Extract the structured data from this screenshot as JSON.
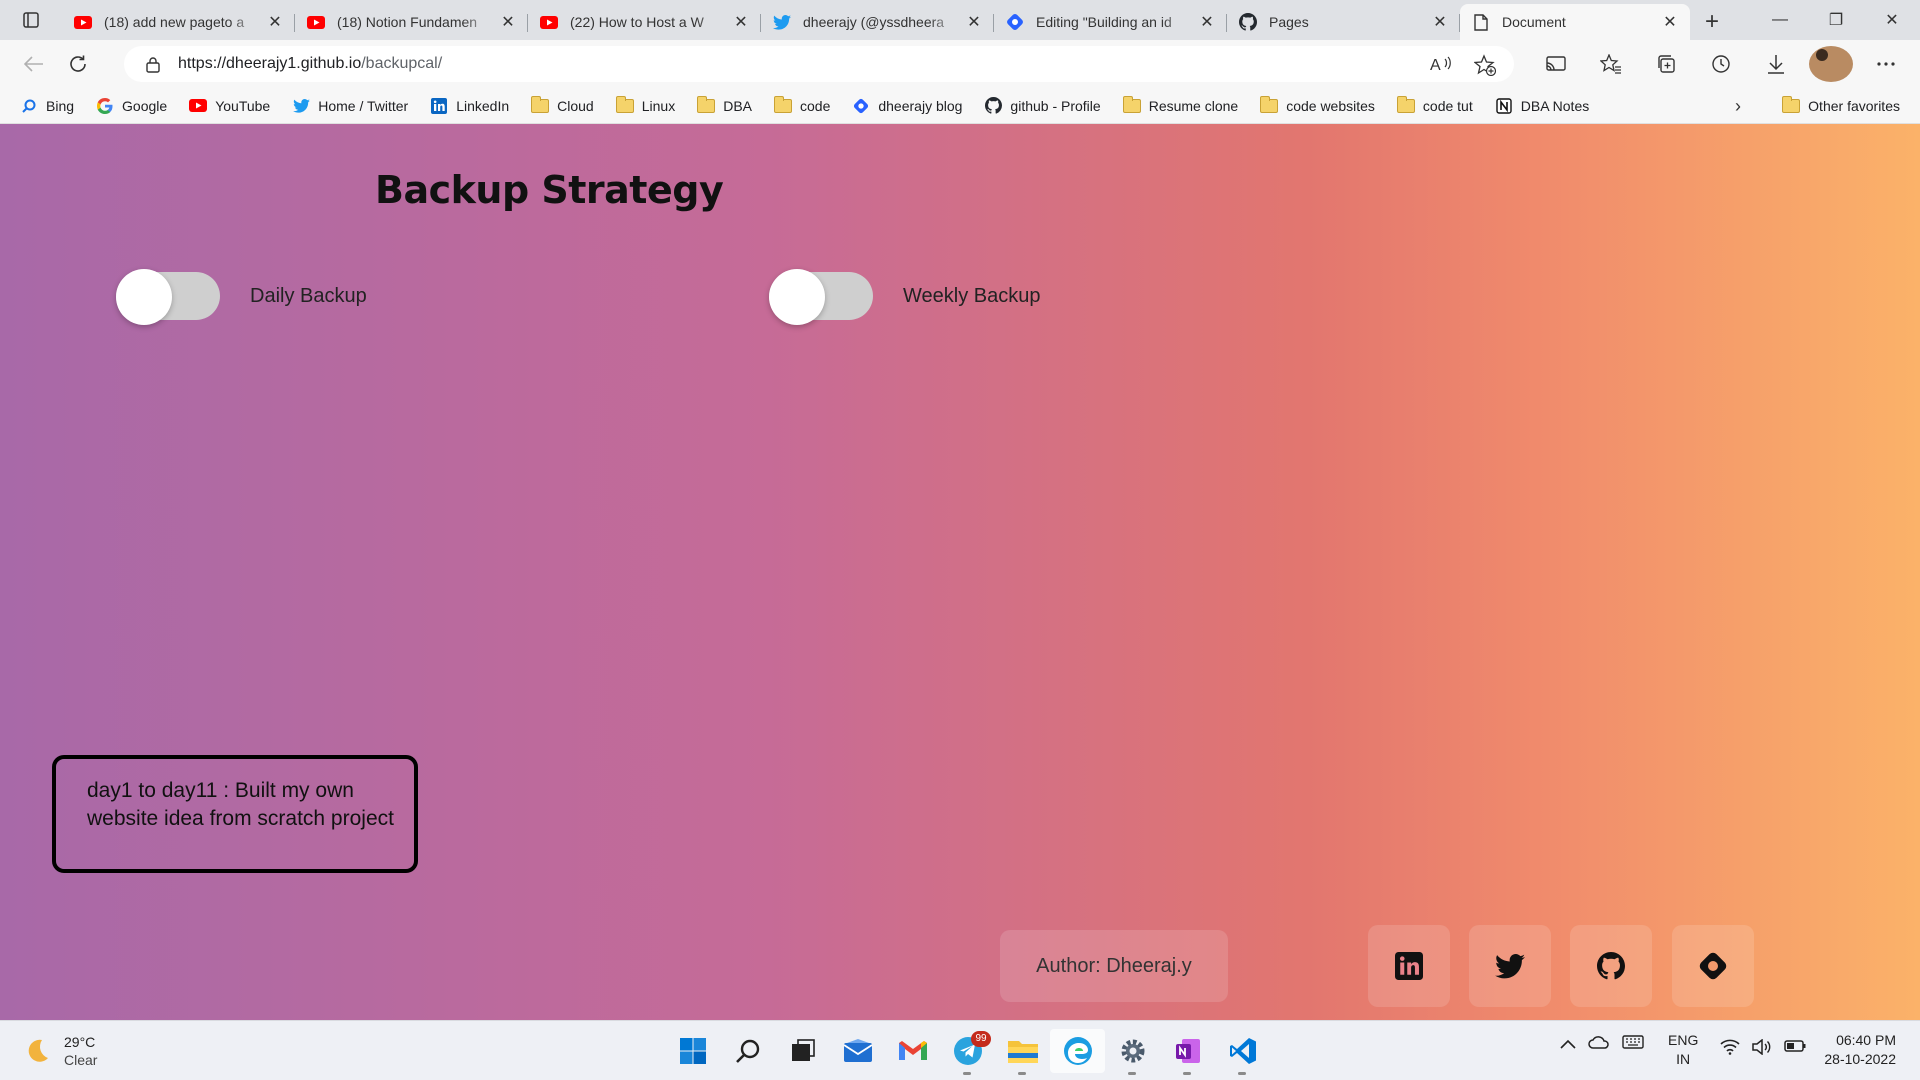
{
  "browser": {
    "tabs": [
      {
        "title": "(18) add new pageto a",
        "icon": "youtube-icon",
        "active": false
      },
      {
        "title": "(18) Notion Fundamen",
        "icon": "youtube-icon",
        "active": false
      },
      {
        "title": "(22) How to Host a W",
        "icon": "youtube-icon",
        "active": false
      },
      {
        "title": "dheerajy (@yssdheera",
        "icon": "twitter-icon",
        "active": false
      },
      {
        "title": "Editing \"Building an id",
        "icon": "hashnode-icon",
        "active": false
      },
      {
        "title": "Pages",
        "icon": "github-icon",
        "active": false
      },
      {
        "title": "Document",
        "icon": "page-icon",
        "active": true
      }
    ],
    "url_host": "https://dheerajy1.github.io",
    "url_path": "/backupcal/",
    "favorites": [
      {
        "label": "Bing",
        "icon": "search-icon"
      },
      {
        "label": "Google",
        "icon": "google-icon"
      },
      {
        "label": "YouTube",
        "icon": "youtube-icon"
      },
      {
        "label": "Home / Twitter",
        "icon": "twitter-icon"
      },
      {
        "label": "LinkedIn",
        "icon": "linkedin-icon"
      },
      {
        "label": "Cloud",
        "icon": "folder-icon"
      },
      {
        "label": "Linux",
        "icon": "folder-icon"
      },
      {
        "label": "DBA",
        "icon": "folder-icon"
      },
      {
        "label": "code",
        "icon": "folder-icon"
      },
      {
        "label": "dheerajy blog",
        "icon": "hashnode-icon"
      },
      {
        "label": "github - Profile",
        "icon": "github-icon"
      },
      {
        "label": "Resume clone",
        "icon": "folder-icon"
      },
      {
        "label": "code websites",
        "icon": "folder-icon"
      },
      {
        "label": "code tut",
        "icon": "folder-icon"
      },
      {
        "label": "DBA Notes",
        "icon": "notion-icon"
      }
    ],
    "other_favorites": "Other favorites"
  },
  "page": {
    "title": "Backup Strategy",
    "toggles": [
      {
        "label": "Daily Backup",
        "checked": false
      },
      {
        "label": "Weekly Backup",
        "checked": false
      }
    ],
    "note": "day1 to day11 : Built my own website idea from scratch project",
    "author": "Author: Dheeraj.y",
    "social_links": [
      "linkedin-icon",
      "twitter-icon",
      "github-icon",
      "hashnode-icon"
    ],
    "gradient_colors": [
      "#a869a8",
      "#c66b97",
      "#e2766f",
      "#fbb269"
    ]
  },
  "taskbar": {
    "weather_temp": "29°C",
    "weather_desc": "Clear",
    "telegram_badge": "99",
    "lang_top": "ENG",
    "lang_bottom": "IN",
    "time": "06:40 PM",
    "date": "28-10-2022"
  }
}
